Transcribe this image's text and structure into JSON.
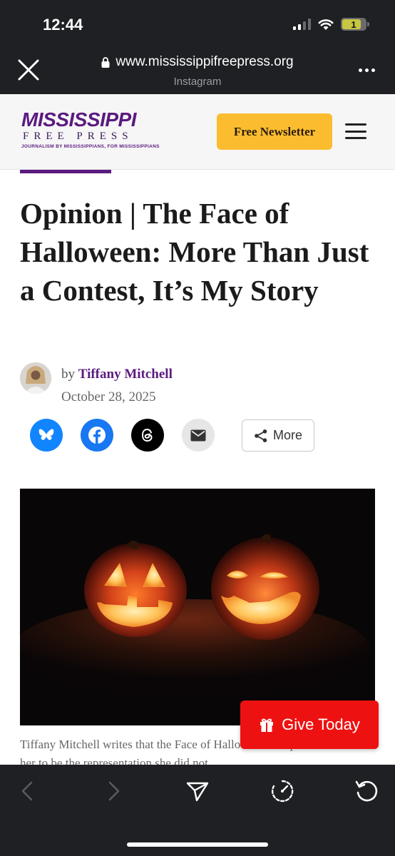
{
  "status_bar": {
    "time": "12:44",
    "battery": "1"
  },
  "browser": {
    "url": "www.mississippifreepress.org",
    "source": "Instagram"
  },
  "site": {
    "logo_line1": "MISSISSIPPI",
    "logo_line2": "FREE PRESS",
    "logo_tagline": "JOURNALISM BY MISSISSIPPIANS, FOR MISSISSIPPIANS",
    "newsletter_label": "Free Newsletter",
    "brand_color": "#5b1a80",
    "newsletter_color": "#fbbd2f"
  },
  "article": {
    "title": "Opinion | The Face of Halloween: More Than Just a Contest, It’s My Story",
    "by": "by",
    "author": "Tiffany Mitchell",
    "date": "October 28, 2025",
    "caption": "Tiffany Mitchell writes that the Face of Halloween competition allows her to be the representation she did not"
  },
  "share": {
    "buttons": [
      "bluesky-icon",
      "facebook-icon",
      "threads-icon",
      "email-icon"
    ],
    "more_label": "More"
  },
  "donate": {
    "label": "Give Today",
    "color": "#ee1111"
  }
}
